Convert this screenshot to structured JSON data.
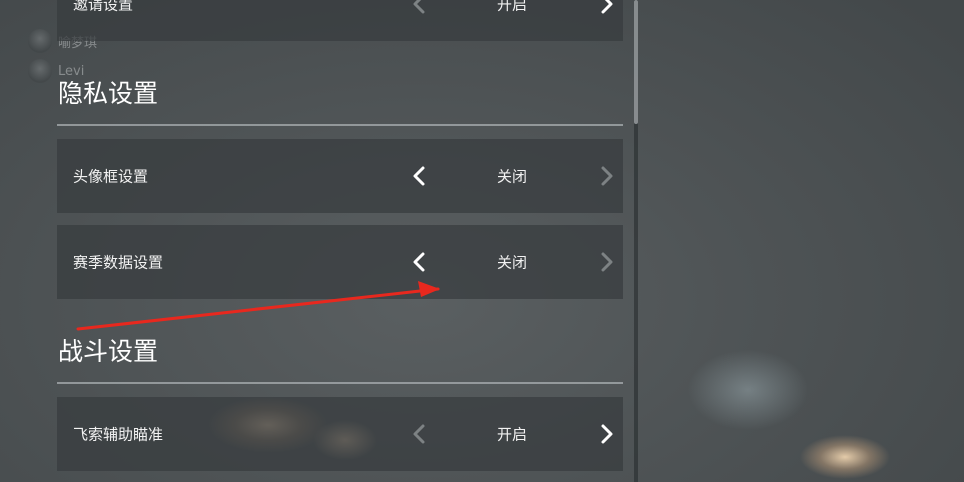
{
  "players": [
    {
      "name": "喻梦琪"
    },
    {
      "name": "Levi"
    }
  ],
  "top_row": {
    "label": "邀请设置",
    "value": "开启"
  },
  "privacy_section": {
    "title": "隐私设置",
    "rows": [
      {
        "label": "头像框设置",
        "value": "关闭"
      },
      {
        "label": "赛季数据设置",
        "value": "关闭"
      }
    ]
  },
  "battle_section": {
    "title": "战斗设置",
    "rows": [
      {
        "label": "飞索辅助瞄准",
        "value": "开启"
      }
    ]
  },
  "colors": {
    "annotation_arrow": "#e8281e",
    "arrow_active": "#ffffff",
    "arrow_disabled": "#7d8284"
  },
  "icons": {
    "left": "chevron-left-icon",
    "right": "chevron-right-icon",
    "annotation": "red-arrow-annotation"
  }
}
